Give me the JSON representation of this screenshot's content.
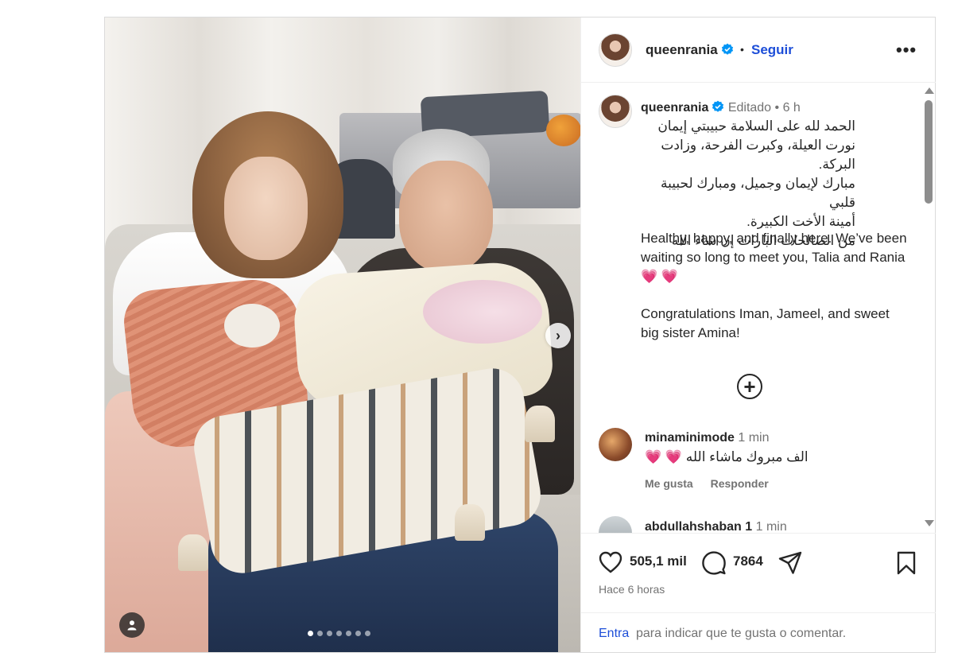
{
  "header": {
    "username": "queenrania",
    "follow_label": "Seguir",
    "more_icon": "more-horizontal-icon"
  },
  "caption": {
    "username": "queenrania",
    "edited_label": "Editado",
    "time": "6 h",
    "arabic_lines": [
      "الحمد لله على السلامة حبيبتي إيمان",
      "نورت العيلة، وكبرت الفرحة، وزادت البركة.",
      "مبارك لإيمان وجميل، ومبارك لحبيبة قلبي",
      "أمينة الأخت الكبيرة.",
      "من الصالحات البارات إن شاء الله"
    ],
    "english_para1": "Healthy, happy, and finally here. We’ve been waiting so long to meet you, Talia and Rania",
    "english_para1_emoji": "💗 💗",
    "english_para2": "Congratulations Iman, Jameel, and sweet big sister Amina!"
  },
  "comments": [
    {
      "username": "minaminimode",
      "time": "1 min",
      "text": "الف مبروك ماشاء الله",
      "emoji": "💗 💗",
      "like_label": "Me gusta",
      "reply_label": "Responder"
    },
    {
      "username": "abdullahshaban 1",
      "time": "1 min"
    }
  ],
  "actions": {
    "likes": "505,1 mil",
    "comments": "7864",
    "time_ago": "Hace 6 horas"
  },
  "footer": {
    "login_link": "Entra",
    "login_text": "para indicar que te gusta o comentar."
  },
  "carousel": {
    "total_slides": 7,
    "active_slide": 1
  },
  "colors": {
    "link_blue": "#1d4ed8",
    "verified_blue": "#0095f6",
    "heart_pink": "#ec2b78",
    "muted_text": "#737373"
  }
}
